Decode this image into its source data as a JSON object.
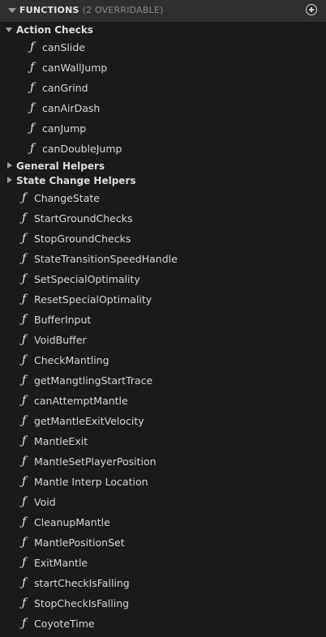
{
  "header": {
    "title": "FUNCTIONS",
    "subtitle": "(2 OVERRIDABLE)"
  },
  "categories": [
    {
      "label": "Action Checks",
      "expanded": true,
      "items": [
        "canSlide",
        "canWallJump",
        "canGrind",
        "canAirDash",
        "canJump",
        "canDoubleJump"
      ]
    },
    {
      "label": "General Helpers",
      "expanded": false,
      "items": []
    },
    {
      "label": "State Change Helpers",
      "expanded": false,
      "items": []
    }
  ],
  "functions": [
    "ChangeState",
    "StartGroundChecks",
    "StopGroundChecks",
    "StateTransitionSpeedHandle",
    "SetSpecialOptimality",
    "ResetSpecialOptimality",
    "BufferInput",
    "VoidBuffer",
    "CheckMantling",
    "getMangtlingStartTrace",
    "canAttemptMantle",
    "getMantleExitVelocity",
    "MantleExit",
    "MantleSetPlayerPosition",
    "Mantle Interp Location",
    "Void",
    "CleanupMantle",
    "MantlePositionSet",
    "ExitMantle",
    "startCheckIsFalling",
    "StopCheckIsFalling",
    "CoyoteTime"
  ],
  "icons": {
    "function": "function-icon",
    "add": "add-function-icon",
    "collapse": "collapse-caret-icon"
  },
  "colors": {
    "panel_bg": "#1a1a1a",
    "header_bg": "#2f2f2f",
    "text": "#d6d6d6",
    "subtitle": "#8a8a8a"
  }
}
